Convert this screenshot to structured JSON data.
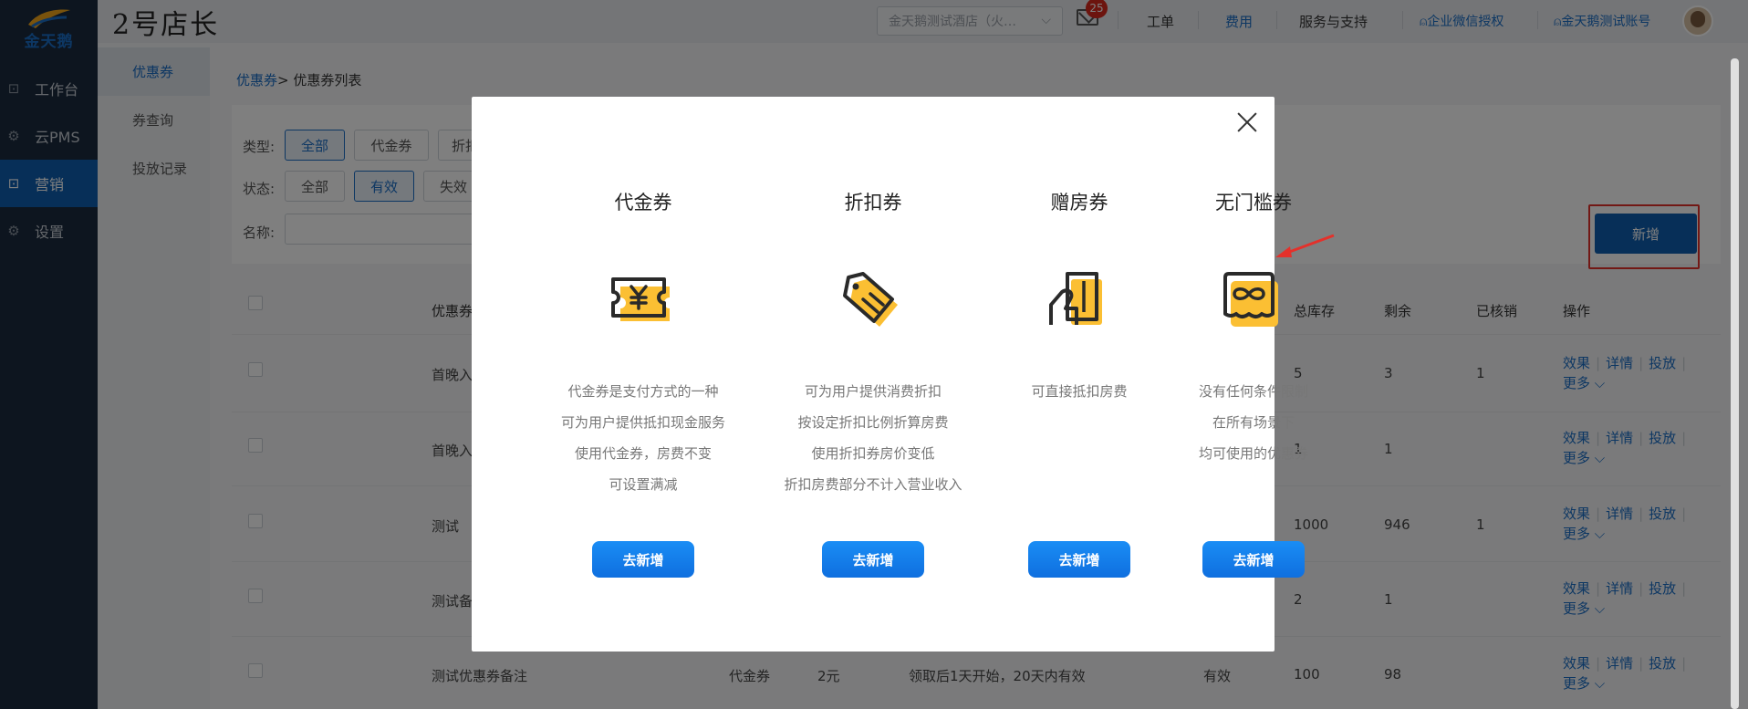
{
  "logo": {
    "text": "金天鹅"
  },
  "leftnav": [
    {
      "label": "工作台",
      "icon": "grid-icon"
    },
    {
      "label": "云PMS",
      "icon": "gear-icon"
    },
    {
      "label": "营销",
      "icon": "grid-icon",
      "active": true
    },
    {
      "label": "设置",
      "icon": "gear-icon"
    }
  ],
  "subnav": [
    {
      "label": "优惠券",
      "active": true
    },
    {
      "label": "券查询"
    },
    {
      "label": "投放记录"
    }
  ],
  "topbar": {
    "brand": "2号店长",
    "hotel_select": "金天鹅测试酒店（火…",
    "mail_badge": "25",
    "links": {
      "ticket": "工单",
      "fee": "费用",
      "support": "服务与支持",
      "wechat": "企业微信授权",
      "account": "金天鹅测试账号"
    }
  },
  "breadcrumb": {
    "root": "优惠券",
    "sep": ">",
    "current": " 优惠券列表"
  },
  "filters": {
    "type_label": "类型:",
    "type_options": [
      "全部",
      "代金券",
      "折扣"
    ],
    "status_label": "状态:",
    "status_options": [
      "全部",
      "有效",
      "失效"
    ],
    "name_label": "名称:"
  },
  "add_button": "新增",
  "table": {
    "headers": {
      "name": "优惠券",
      "stock": "总库存",
      "remain": "剩余",
      "used": "已核销",
      "ops": "操作"
    },
    "rows": [
      {
        "name": "首晚入",
        "stock": "5",
        "remain": "3",
        "used": "1"
      },
      {
        "name": "首晚入",
        "stock": "1",
        "remain": "1",
        "used": ""
      },
      {
        "name": "测试",
        "stock": "1000",
        "remain": "946",
        "used": "1"
      },
      {
        "name": "测试备",
        "stock": "2",
        "remain": "1",
        "used": ""
      },
      {
        "name": "测试优惠券备注",
        "type": "代金券",
        "value": "2元",
        "validity": "领取后1天开始，20天内有效",
        "status": "有效",
        "stock": "100",
        "remain": "98",
        "used": ""
      }
    ],
    "ops": {
      "effect": "效果",
      "detail": "详情",
      "deliver": "投放",
      "more": "更多"
    }
  },
  "modal": {
    "columns": [
      {
        "title": "代金券",
        "icon": "yen-ticket-icon",
        "desc": [
          "代金券是支付方式的一种",
          "可为用户提供抵扣现金服务",
          "使用代金券，房费不变",
          "可设置满减"
        ],
        "button": "去新增"
      },
      {
        "title": "折扣券",
        "icon": "discount-tag-icon",
        "desc": [
          "可为用户提供消费折扣",
          "按设定折扣比例折算房费",
          "使用折扣券房价变低",
          "折扣房费部分不计入营业收入"
        ],
        "button": "去新增"
      },
      {
        "title": "赠房券",
        "icon": "gift-room-icon",
        "desc": [
          "可直接抵扣房费"
        ],
        "button": "去新增"
      },
      {
        "title": "无门槛券",
        "icon": "infinity-ticket-icon",
        "desc": [
          "没有任何条件限制",
          "在所有场景下",
          "均可使用的优惠券"
        ],
        "button": "去新增"
      }
    ]
  },
  "colors": {
    "accent": "#1a6ec7",
    "nav_active": "#0f5fb0",
    "icon_yellow": "#fbbf33",
    "highlight_red": "#e4312b"
  }
}
